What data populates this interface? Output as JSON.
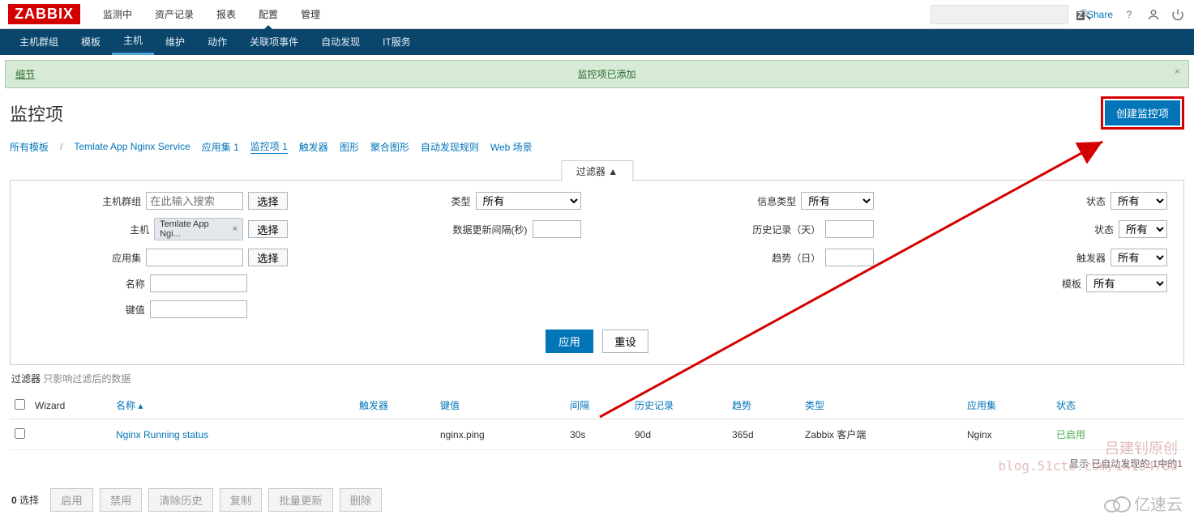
{
  "logo": "ZABBIX",
  "top_nav": [
    "监测中",
    "资产记录",
    "报表",
    "配置",
    "管理"
  ],
  "top_nav_active": 3,
  "share_label": "Share",
  "sub_nav": [
    "主机群组",
    "模板",
    "主机",
    "维护",
    "动作",
    "关联项事件",
    "自动发现",
    "IT服务"
  ],
  "sub_nav_active": 2,
  "banner": {
    "detail": "细节",
    "message": "监控项已添加"
  },
  "page_title": "监控项",
  "create_button": "创建监控项",
  "crumbs": {
    "all_templates": "所有模板",
    "template_name": "Temlate App Nginx Service",
    "app_sets": "应用集 1",
    "items": "监控项 1",
    "triggers": "触发器",
    "graphs": "图形",
    "aggregate": "聚合图形",
    "discovery": "自动发现规则",
    "web": "Web 场景"
  },
  "filter_toggle": "过滤器 ▲",
  "filter": {
    "hostgroup_label": "主机群组",
    "hostgroup_placeholder": "在此输入搜索",
    "select_btn": "选择",
    "host_label": "主机",
    "host_chip": "Temlate App Ngi...",
    "appset_label": "应用集",
    "name_label": "名称",
    "key_label": "键值",
    "type_label": "类型",
    "type_value": "所有",
    "update_interval_label": "数据更新间隔(秒)",
    "history_label": "历史记录（天）",
    "trend_label": "趋势（日）",
    "info_type_label": "信息类型",
    "info_type_value": "所有",
    "state_label": "状态",
    "state_value": "所有",
    "status_label": "状态",
    "status_value": "所有",
    "trigger_label": "触发器",
    "trigger_value": "所有",
    "template_label": "模板",
    "template_value": "所有",
    "apply_btn": "应用",
    "reset_btn": "重设"
  },
  "filter_note_label": "过滤器",
  "filter_note_muted": "只影响过滤后的数据",
  "table": {
    "headers": {
      "wizard": "Wizard",
      "name": "名称",
      "triggers": "触发器",
      "key": "键值",
      "interval": "间隔",
      "history": "历史记录",
      "trends": "趋势",
      "type": "类型",
      "app": "应用集",
      "status": "状态"
    },
    "sort_indicator": "▴",
    "rows": [
      {
        "name": "Nginx Running status",
        "triggers": "",
        "key": "nginx.ping",
        "interval": "30s",
        "history": "90d",
        "trends": "365d",
        "type": "Zabbix 客户端",
        "app": "Nginx",
        "status": "已启用"
      }
    ],
    "footer": "显示 已自动发现的 1中的1"
  },
  "bottom": {
    "selected_count": "0",
    "selected_label": " 选择",
    "enable": "启用",
    "disable": "禁用",
    "clear_history": "清除历史",
    "copy": "复制",
    "mass_update": "批量更新",
    "delete": "删除"
  },
  "watermark": {
    "line1": "吕建钊原创",
    "line2": "blog.51cto.com/14154700"
  },
  "cloud_logo": "亿速云"
}
